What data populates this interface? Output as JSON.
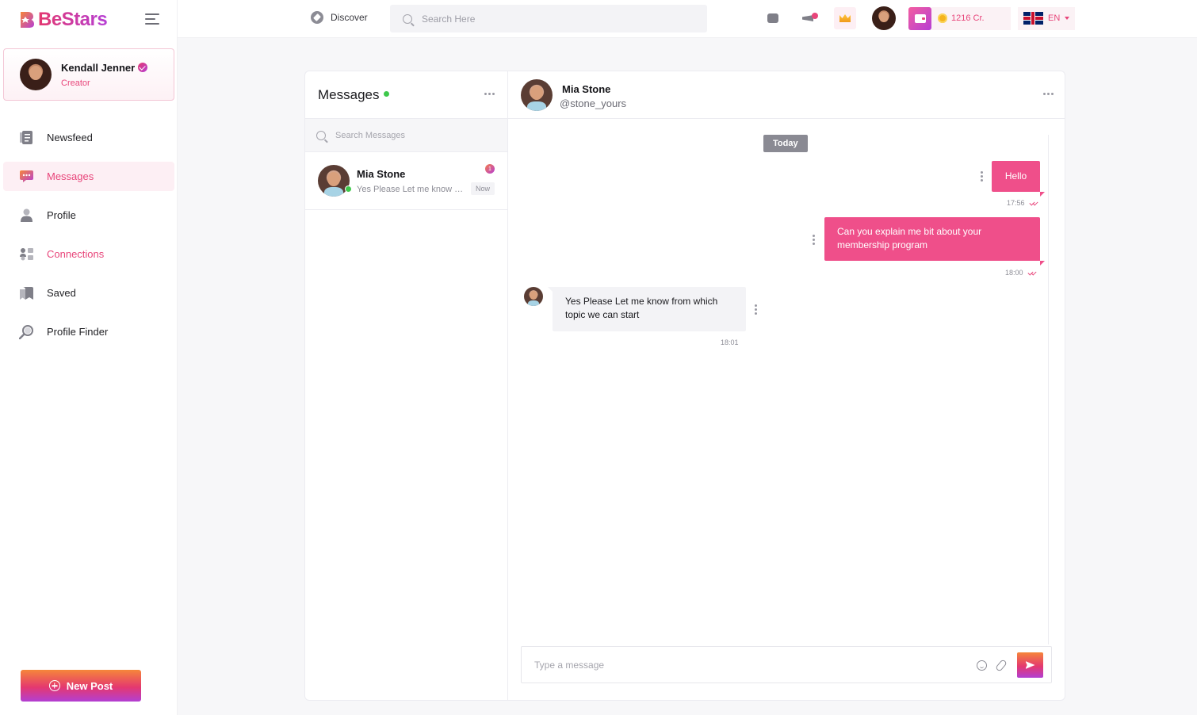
{
  "brand": {
    "name": "BeStars",
    "accent": "#e8457a",
    "gradient": [
      "#f6863a",
      "#e4386f",
      "#b23fd3"
    ]
  },
  "user": {
    "name": "Kendall Jenner",
    "role": "Creator",
    "verified": true
  },
  "sidebar": {
    "items": [
      {
        "label": "Newsfeed",
        "icon": "newsfeed-icon",
        "state": "default"
      },
      {
        "label": "Messages",
        "icon": "messages-icon",
        "state": "active"
      },
      {
        "label": "Profile",
        "icon": "profile-icon",
        "state": "default"
      },
      {
        "label": "Connections",
        "icon": "connections-icon",
        "state": "highlighted"
      },
      {
        "label": "Saved",
        "icon": "saved-icon",
        "state": "default"
      },
      {
        "label": "Profile Finder",
        "icon": "magnifier-icon",
        "state": "default"
      }
    ],
    "new_post_label": "New Post"
  },
  "topbar": {
    "discover_label": "Discover",
    "search_placeholder": "Search Here",
    "credits": "1216 Cr.",
    "language": "EN"
  },
  "messages": {
    "title": "Messages",
    "search_placeholder": "Search Messages",
    "conversations": [
      {
        "name": "Mia Stone",
        "preview": "Yes Please Let me know from which topic we can start",
        "time": "Now",
        "unread": "1",
        "online": true
      }
    ]
  },
  "chat": {
    "contact_name": "Mia Stone",
    "contact_handle": "@stone_yours",
    "date_divider": "Today",
    "messages": [
      {
        "direction": "out",
        "text": "Hello",
        "time": "17:56",
        "read": true
      },
      {
        "direction": "out",
        "text": "Can you explain me bit about your membership program",
        "time": "18:00",
        "read": true
      },
      {
        "direction": "in",
        "text": "Yes Please Let me know from which topic we can start",
        "time": "18:01"
      }
    ],
    "composer_placeholder": "Type a message"
  }
}
